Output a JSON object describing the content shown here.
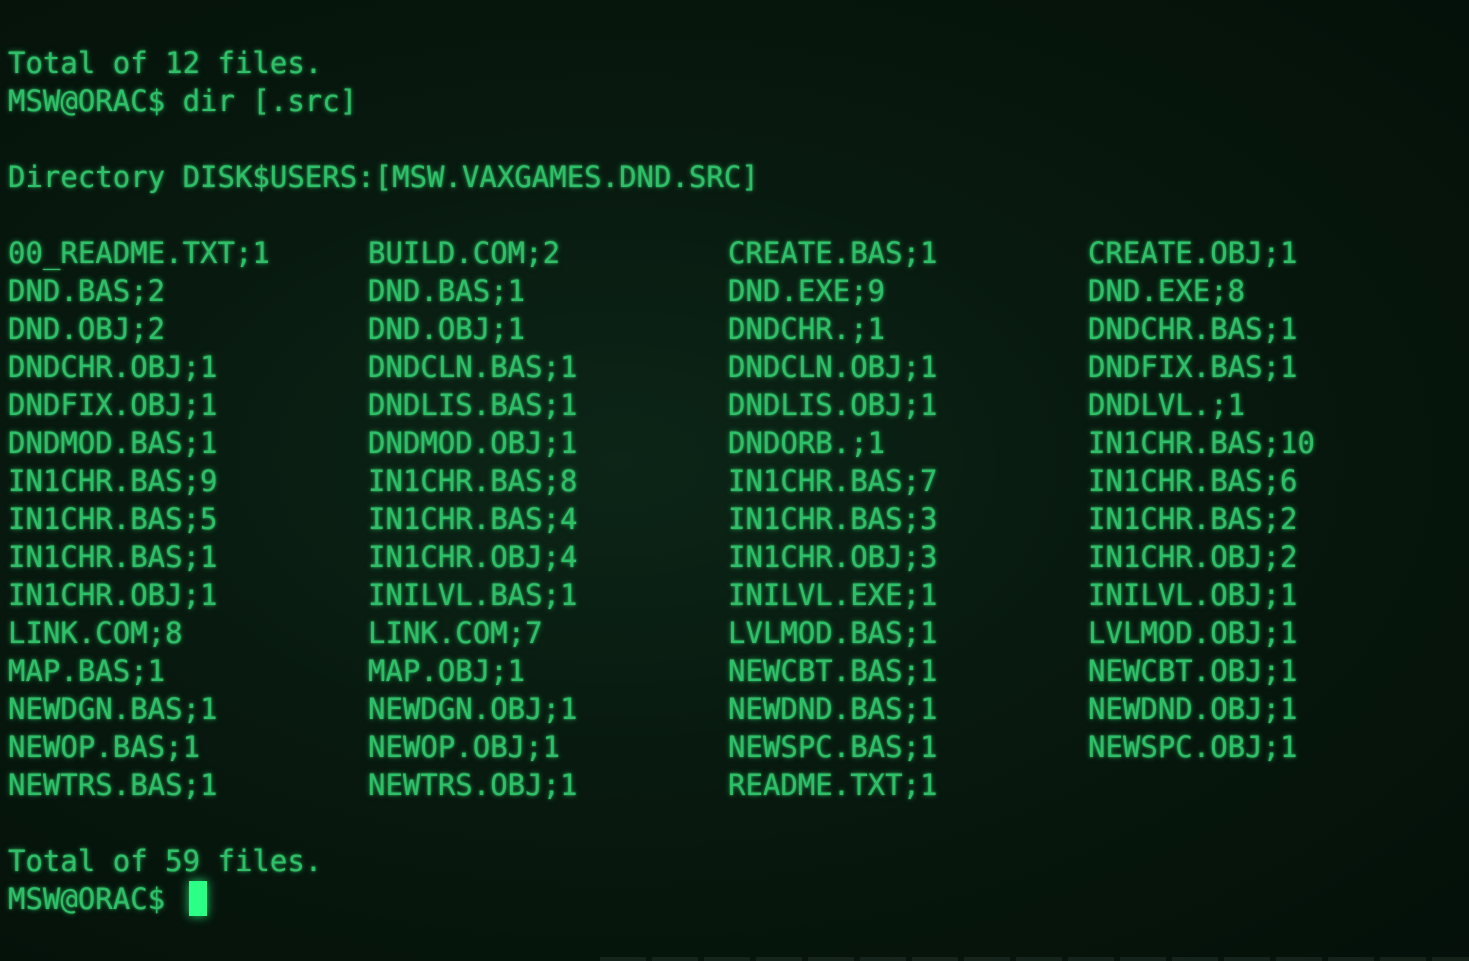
{
  "terminal": {
    "lines": {
      "prev_total": "Total of 12 files.",
      "command": "MSW@ORAC$ dir [.src]",
      "directory": "Directory DISK$USERS:[MSW.VAXGAMES.DND.SRC]",
      "total": "Total of 59 files.",
      "prompt": "MSW@ORAC$ "
    },
    "files": [
      [
        "00_README.TXT;1",
        "BUILD.COM;2",
        "CREATE.BAS;1",
        "CREATE.OBJ;1"
      ],
      [
        "DND.BAS;2",
        "DND.BAS;1",
        "DND.EXE;9",
        "DND.EXE;8"
      ],
      [
        "DND.OBJ;2",
        "DND.OBJ;1",
        "DNDCHR.;1",
        "DNDCHR.BAS;1"
      ],
      [
        "DNDCHR.OBJ;1",
        "DNDCLN.BAS;1",
        "DNDCLN.OBJ;1",
        "DNDFIX.BAS;1"
      ],
      [
        "DNDFIX.OBJ;1",
        "DNDLIS.BAS;1",
        "DNDLIS.OBJ;1",
        "DNDLVL.;1"
      ],
      [
        "DNDMOD.BAS;1",
        "DNDMOD.OBJ;1",
        "DNDORB.;1",
        "IN1CHR.BAS;10"
      ],
      [
        "IN1CHR.BAS;9",
        "IN1CHR.BAS;8",
        "IN1CHR.BAS;7",
        "IN1CHR.BAS;6"
      ],
      [
        "IN1CHR.BAS;5",
        "IN1CHR.BAS;4",
        "IN1CHR.BAS;3",
        "IN1CHR.BAS;2"
      ],
      [
        "IN1CHR.BAS;1",
        "IN1CHR.OBJ;4",
        "IN1CHR.OBJ;3",
        "IN1CHR.OBJ;2"
      ],
      [
        "IN1CHR.OBJ;1",
        "INILVL.BAS;1",
        "INILVL.EXE;1",
        "INILVL.OBJ;1"
      ],
      [
        "LINK.COM;8",
        "LINK.COM;7",
        "LVLMOD.BAS;1",
        "LVLMOD.OBJ;1"
      ],
      [
        "MAP.BAS;1",
        "MAP.OBJ;1",
        "NEWCBT.BAS;1",
        "NEWCBT.OBJ;1"
      ],
      [
        "NEWDGN.BAS;1",
        "NEWDGN.OBJ;1",
        "NEWDND.BAS;1",
        "NEWDND.OBJ;1"
      ],
      [
        "NEWOP.BAS;1",
        "NEWOP.OBJ;1",
        "NEWSPC.BAS;1",
        "NEWSPC.OBJ;1"
      ],
      [
        "NEWTRS.BAS;1",
        "NEWTRS.OBJ;1",
        "README.TXT;1",
        ""
      ]
    ],
    "colors": {
      "text": "#2fbf68",
      "cursor": "#2cff86",
      "background": "#08190f"
    }
  }
}
